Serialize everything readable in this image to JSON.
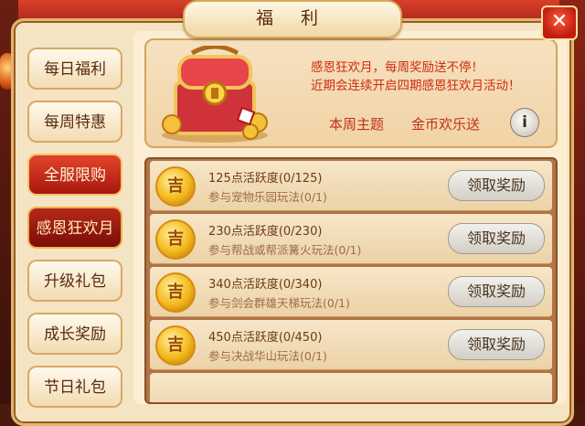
{
  "window": {
    "title": "福 利",
    "close_label": "✕"
  },
  "sidebar": {
    "items": [
      {
        "label": "每日福利",
        "state": "normal"
      },
      {
        "label": "每周特惠",
        "state": "normal"
      },
      {
        "label": "全服限购",
        "state": "active"
      },
      {
        "label": "感恩狂欢月",
        "state": "selected"
      },
      {
        "label": "升级礼包",
        "state": "normal"
      },
      {
        "label": "成长奖励",
        "state": "normal"
      },
      {
        "label": "节日礼包",
        "state": "normal"
      }
    ]
  },
  "banner": {
    "line1": "感恩狂欢月，每周奖励送不停！",
    "line2": "近期会连续开启四期感恩狂欢月活动！",
    "topic_label": "本周主题",
    "topic_value": "金币欢乐送",
    "info_label": "i"
  },
  "tasks": [
    {
      "title": "125点活跃度(0/125)",
      "subtitle": "参与宠物乐园玩法(0/1)",
      "button": "领取奖励"
    },
    {
      "title": "230点活跃度(0/230)",
      "subtitle": "参与帮战或帮派篝火玩法(0/1)",
      "button": "领取奖励"
    },
    {
      "title": "340点活跃度(0/340)",
      "subtitle": "参与剑会群雄天梯玩法(0/1)",
      "button": "领取奖励"
    },
    {
      "title": "450点活跃度(0/450)",
      "subtitle": "参与决战华山玩法(0/1)",
      "button": "领取奖励"
    }
  ],
  "colors": {
    "accent_red": "#d02b10",
    "panel_cream": "#f5e4c3",
    "list_brown": "#b07446"
  }
}
